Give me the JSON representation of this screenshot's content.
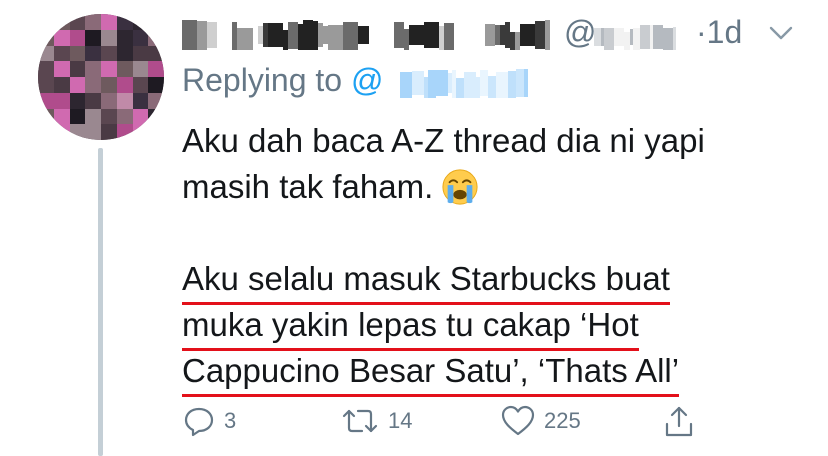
{
  "tweet": {
    "handle_at": "@",
    "time": "·1d",
    "replying_prefix": "Replying to ",
    "replying_at": "@",
    "lines": [
      "Aku dah baca A-Z thread dia ni yapi",
      "masih tak faham."
    ],
    "highlighted_lines": [
      "Aku selalu masuk Starbucks buat",
      "muka yakin lepas tu cakap ‘Hot",
      "Cappucino Besar Satu’, ‘Thats All’"
    ],
    "emoji": "crying-face-icon",
    "counts": {
      "replies": "3",
      "retweets": "14",
      "likes": "225"
    }
  },
  "colors": {
    "text": "#14171a",
    "muted": "#657786",
    "link": "#1da1f2",
    "underline": "#e3101a",
    "thread_line": "#c4cfd6"
  }
}
